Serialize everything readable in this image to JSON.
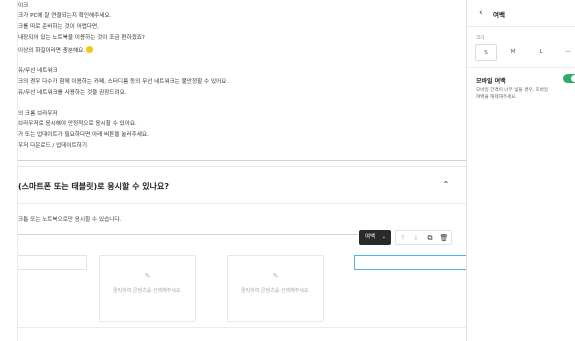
{
  "content": {
    "lines": [
      "이크",
      "크가 PC에 잘 연결되는지 확인해주세요.",
      "크를 따로 준비하는 것이 어렵다면,",
      "내장되어 있는 노트북을 이용하는 것이 조금 편하겠죠?",
      "이상의 화질이라면 충분해요.",
      "유/무선 네트워크",
      "크의 경우 다수가 함께 이용하는 카페, 스터디룸 등의 무선 네트워크는 불안정할 수 있어요.",
      "유/무선 네트워크를 사용하는 것을 권장드려요.",
      "의 크롬 브라우저",
      "브라우저로 응시해야 안정적으로 응시할 수 있어요.",
      "가 또는 업데이트가 필요하다면 아래 버튼을 눌러주세요.",
      "우저 다운로드 / 업데이트하기"
    ],
    "faq_title": "(스마트폰 또는 태블릿)로 응시할 수 있나요?",
    "faq_answer": "크톱 또는 노트북으로만 응시할 수 있습니다."
  },
  "toolbar": {
    "spacing_label": "여백",
    "icons": [
      "arrow-up-icon",
      "arrow-down-icon",
      "copy-icon",
      "trash-icon"
    ]
  },
  "blocks": {
    "empty_text": "클릭하여 콘텐츠를 선택해주세요."
  },
  "panel": {
    "title": "여백",
    "size_label": "크기",
    "size_options": [
      "S",
      "M",
      "L",
      "—"
    ],
    "selected_size": "S",
    "mobile_title": "모바일 여백",
    "mobile_desc_1": "모바일 간격이 너무 넓을 경우, 모바일",
    "mobile_desc_2": "여백을 해제해주세요.",
    "toggle_on": true,
    "accent_color": "#2eaa6a",
    "selection_color": "#4cb2f0"
  }
}
